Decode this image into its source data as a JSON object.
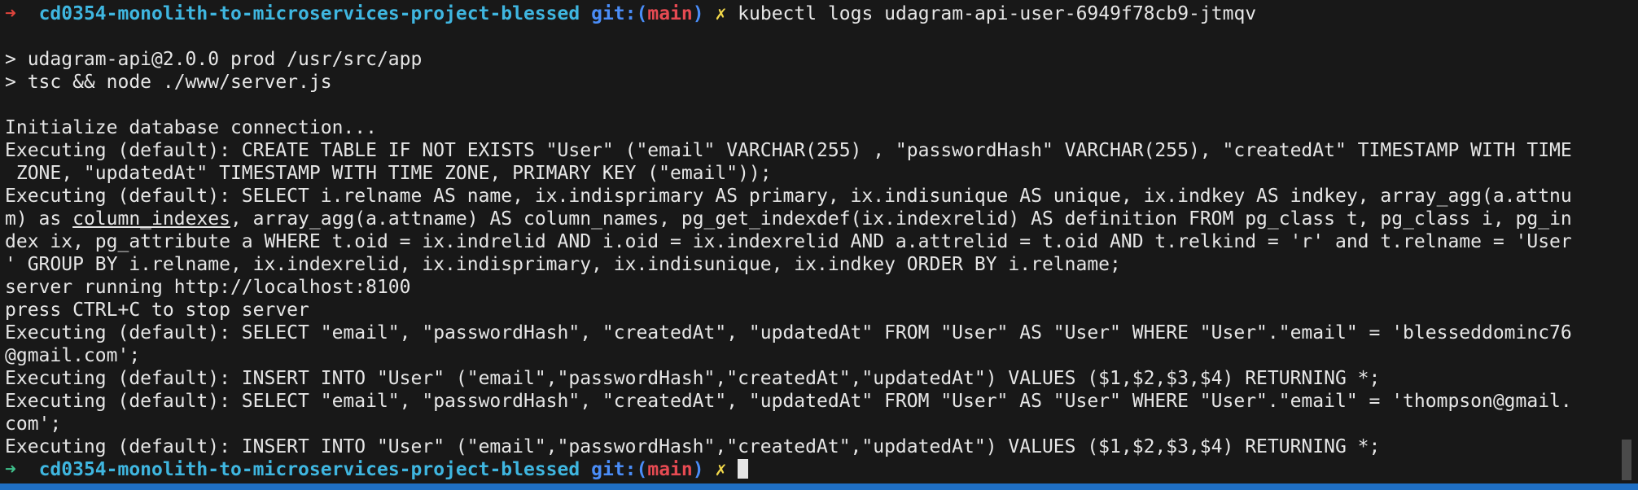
{
  "prompt": {
    "arrow": "➜",
    "directory": "cd0354-monolith-to-microservices-project-blessed",
    "git_label": "git:(",
    "branch": "main",
    "git_close": ")",
    "dirty_mark": "✗"
  },
  "command": "kubectl logs udagram-api-user-6949f78cb9-jtmqv",
  "output": {
    "l1": "> udagram-api@2.0.0 prod /usr/src/app",
    "l2": "> tsc && node ./www/server.js",
    "l3": "Initialize database connection...",
    "l4": "Executing (default): CREATE TABLE IF NOT EXISTS \"User\" (\"email\" VARCHAR(255) , \"passwordHash\" VARCHAR(255), \"createdAt\" TIMESTAMP WITH TIME",
    "l5": " ZONE, \"updatedAt\" TIMESTAMP WITH TIME ZONE, PRIMARY KEY (\"email\"));",
    "l6": "Executing (default): SELECT i.relname AS name, ix.indisprimary AS primary, ix.indisunique AS unique, ix.indkey AS indkey, array_agg(a.attnu",
    "l7a": "m) as ",
    "l7b": "column_indexes",
    "l7c": ", array_agg(a.attname) AS column_names, pg_get_indexdef(ix.indexrelid) AS definition FROM pg_class t, pg_class i, pg_in",
    "l8": "dex ix, pg_attribute a WHERE t.oid = ix.indrelid AND i.oid = ix.indexrelid AND a.attrelid = t.oid AND t.relkind = 'r' and t.relname = 'User",
    "l9": "' GROUP BY i.relname, ix.indexrelid, ix.indisprimary, ix.indisunique, ix.indkey ORDER BY i.relname;",
    "l10": "server running http://localhost:8100",
    "l11": "press CTRL+C to stop server",
    "l12": "Executing (default): SELECT \"email\", \"passwordHash\", \"createdAt\", \"updatedAt\" FROM \"User\" AS \"User\" WHERE \"User\".\"email\" = 'blesseddominc76",
    "l13": "@gmail.com';",
    "l14": "Executing (default): INSERT INTO \"User\" (\"email\",\"passwordHash\",\"createdAt\",\"updatedAt\") VALUES ($1,$2,$3,$4) RETURNING *;",
    "l15": "Executing (default): SELECT \"email\", \"passwordHash\", \"createdAt\", \"updatedAt\" FROM \"User\" AS \"User\" WHERE \"User\".\"email\" = 'thompson@gmail.",
    "l16": "com';",
    "l17": "Executing (default): INSERT INTO \"User\" (\"email\",\"passwordHash\",\"createdAt\",\"updatedAt\") VALUES ($1,$2,$3,$4) RETURNING *;"
  },
  "colors": {
    "background": "#181818",
    "text": "#e6e6e6",
    "error_arrow": "#e0443c",
    "ok_arrow": "#3fc08c",
    "directory": "#3fb6e0",
    "git": "#4a8df8",
    "branch": "#e64a52",
    "dirty": "#f2d84a",
    "status_bar": "#1f6fc4"
  }
}
